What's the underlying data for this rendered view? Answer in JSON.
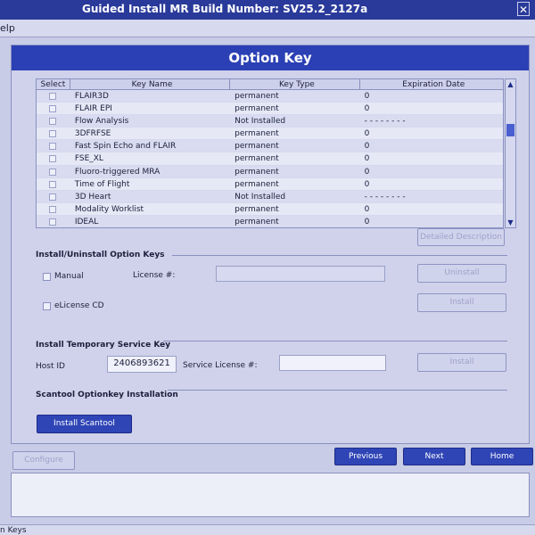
{
  "window": {
    "title": "Guided Install  MR Build Number: SV25.2_2127a",
    "close_glyph": "✕"
  },
  "menubar": {
    "help_label": "elp"
  },
  "page": {
    "title": "Option Key"
  },
  "table": {
    "headers": {
      "select": "Select",
      "key_name": "Key Name",
      "key_type": "Key Type",
      "expiration": "Expiration Date"
    },
    "rows": [
      {
        "name": "FLAIR3D",
        "type": "permanent",
        "exp": "0"
      },
      {
        "name": "FLAIR EPI",
        "type": "permanent",
        "exp": "0"
      },
      {
        "name": "Flow Analysis",
        "type": "Not Installed",
        "exp": "- - - - - - - -"
      },
      {
        "name": "3DFRFSE",
        "type": "permanent",
        "exp": "0"
      },
      {
        "name": "Fast Spin Echo  and FLAIR",
        "type": "permanent",
        "exp": "0"
      },
      {
        "name": "FSE_XL",
        "type": "permanent",
        "exp": "0"
      },
      {
        "name": "Fluoro-triggered  MRA",
        "type": "permanent",
        "exp": "0"
      },
      {
        "name": "Time of Flight",
        "type": "permanent",
        "exp": "0"
      },
      {
        "name": "3D Heart",
        "type": "Not Installed",
        "exp": "- - - - - - - -"
      },
      {
        "name": "Modality  Worklist",
        "type": "permanent",
        "exp": "0"
      },
      {
        "name": "IDEAL",
        "type": "permanent",
        "exp": "0"
      }
    ]
  },
  "buttons": {
    "detailed": "Detailed Description",
    "uninstall": "Uninstall",
    "install": "Install",
    "install_temp": "Install",
    "install_scantool": "Install Scantool",
    "configure": "Configure",
    "previous": "Previous",
    "next": "Next",
    "home": "Home"
  },
  "install_section": {
    "title": "Install/Uninstall Option Keys",
    "manual_label": "Manual",
    "license_label": "License #:",
    "elicense_label": "eLicense CD"
  },
  "temp_section": {
    "title": "Install Temporary Service Key",
    "host_label": "Host ID",
    "host_value": "2406893621",
    "service_license_label": "Service License #:"
  },
  "scantool_section": {
    "title": "Scantool Optionkey Installation"
  },
  "statusbar": {
    "text": "n Keys"
  }
}
